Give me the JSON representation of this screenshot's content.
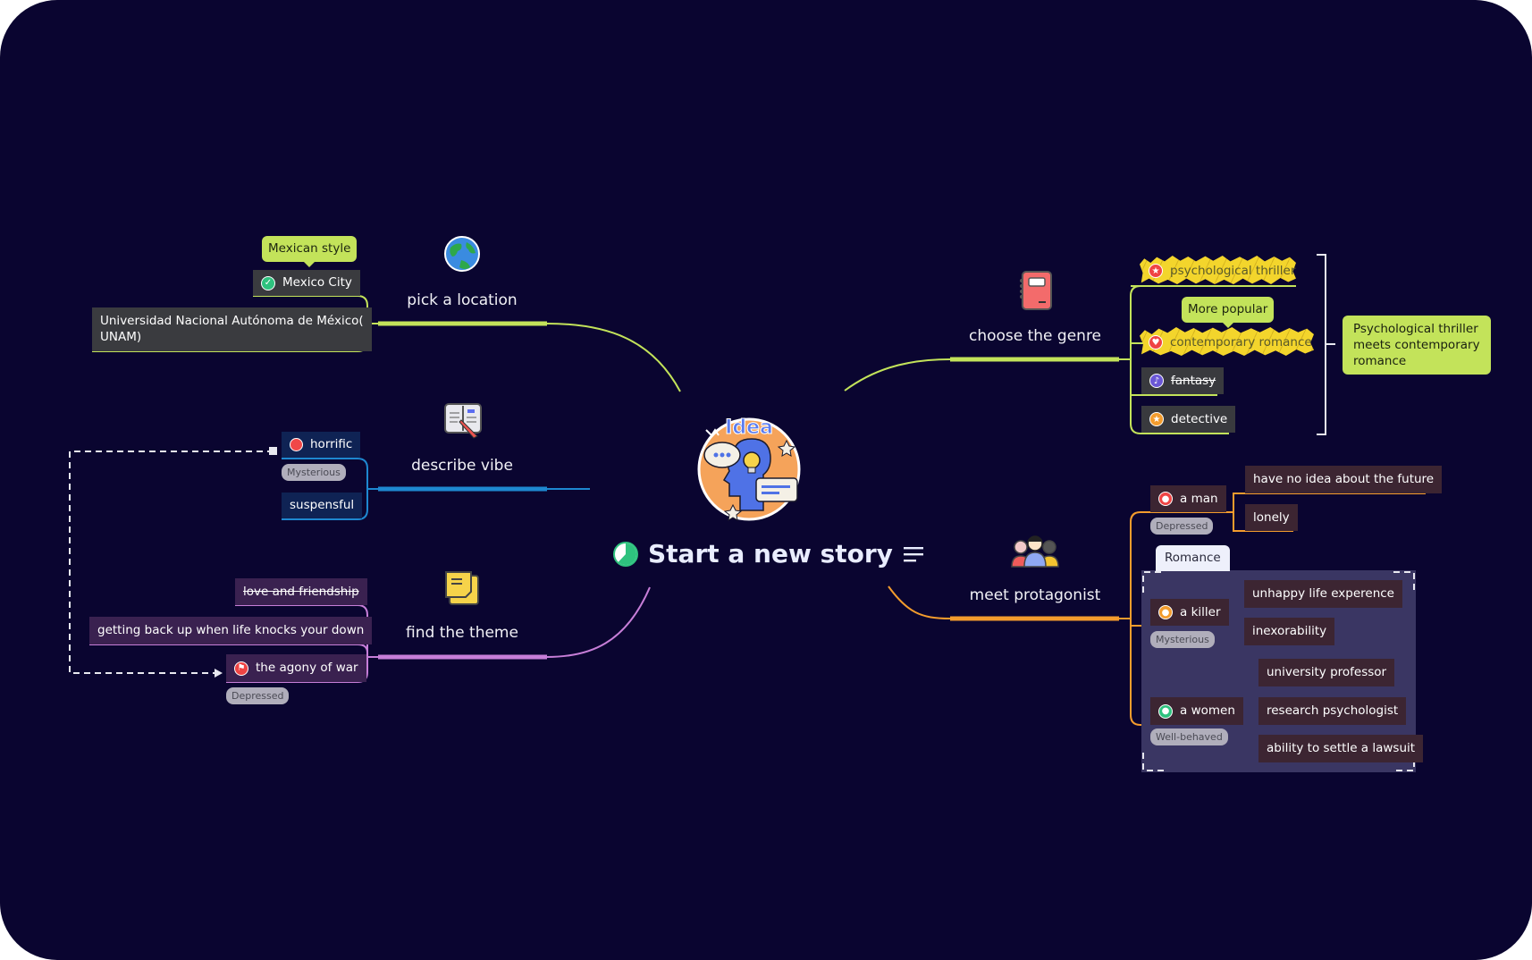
{
  "central": {
    "title": "Start a new story",
    "image_label": "Idea",
    "progress_percent": 62,
    "icons": {
      "progress": "progress-pie-icon",
      "notes": "notes-lines-icon",
      "image": "idea-head-illustration"
    }
  },
  "colors": {
    "background": "#0a0530",
    "location": "#c3e35a",
    "vibe": "#1e88d0",
    "theme": "#c77ed8",
    "genre": "#c3e35a",
    "protagonist": "#f39c2d",
    "callout": "#c3e35a",
    "group_fill": "#3a3663"
  },
  "branches": {
    "location": {
      "label": "pick a location",
      "icon": "globe-icon",
      "children": [
        {
          "text": "Mexico City",
          "marker": "check-circle-icon",
          "callout": "Mexican style"
        },
        {
          "text": "Universidad Nacional Autónoma de México(",
          "text2": "UNAM)"
        }
      ]
    },
    "vibe": {
      "label": "describe vibe",
      "icon": "open-book-pencil-icon",
      "children": [
        {
          "text": "horrific",
          "marker": "red-dot-icon",
          "tag": "Mysterious"
        },
        {
          "text": "suspensful"
        }
      ]
    },
    "theme": {
      "label": "find the theme",
      "icon": "sticky-note-icon",
      "children": [
        {
          "text": "love and friendship",
          "strikethrough": true
        },
        {
          "text": "getting back up when life knocks your down"
        },
        {
          "text": "the agony of war",
          "marker": "flag-icon",
          "tag": "Depressed"
        }
      ]
    },
    "genre": {
      "label": "choose the genre",
      "icon": "notebook-icon",
      "children": [
        {
          "text": "psychological thriller",
          "marker": "star-badge-icon",
          "scribbled": true
        },
        {
          "text": "contemporary romance",
          "marker": "heart-badge-icon",
          "scribbled": true,
          "callout": "More popular"
        },
        {
          "text": "fantasy",
          "marker": "music-note-icon",
          "strikethrough": true
        },
        {
          "text": "detective",
          "marker": "star-orange-icon"
        }
      ],
      "summary": "Psychological thriller meets contemporary romance"
    },
    "protagonist": {
      "label": "meet protagonist",
      "icon": "people-group-icon",
      "group_label": "Romance",
      "children": [
        {
          "text": "a man",
          "marker": "person-red-icon",
          "tag": "Depressed",
          "traits": [
            "have no idea about the future",
            "lonely"
          ]
        },
        {
          "text": "a killer",
          "marker": "person-orange-icon",
          "tag": "Mysterious",
          "traits": [
            "unhappy life experence",
            "inexorability"
          ]
        },
        {
          "text": "a women",
          "marker": "person-green-icon",
          "tag": "Well-behaved",
          "traits": [
            "university professor",
            "research psychologist",
            "ability to settle a lawsuit"
          ]
        }
      ]
    }
  }
}
